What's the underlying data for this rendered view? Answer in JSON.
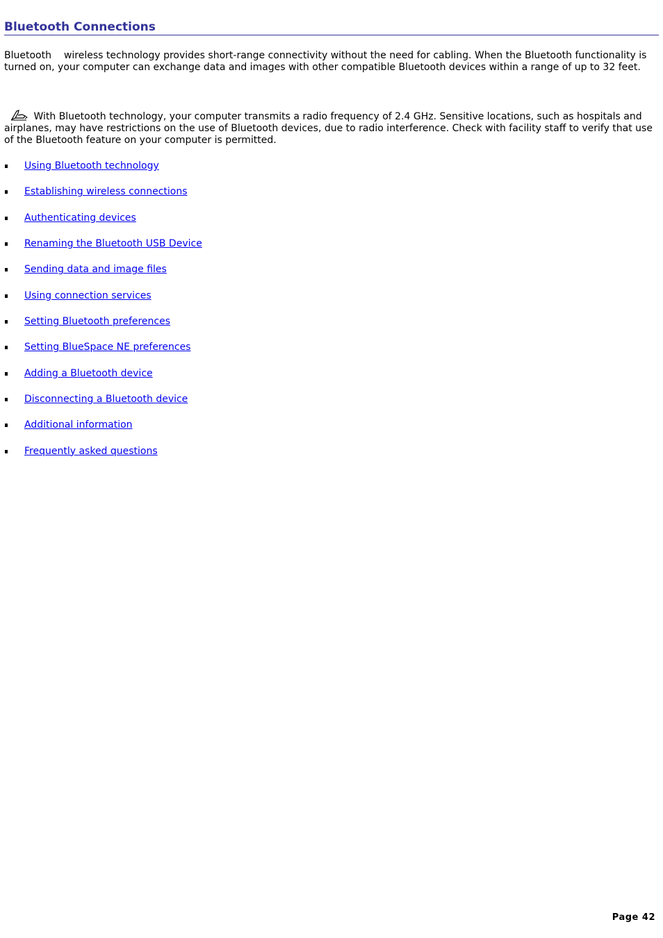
{
  "page": {
    "title": "Bluetooth Connections",
    "intro_prefix": "Bluetooth",
    "intro_rest": "wireless technology provides short-range connectivity without the need for cabling. When the Bluetooth functionality is turned on, your computer can exchange data and images with other compatible Bluetooth devices within a range of up to 32 feet.",
    "note_icon": "note-pen-icon",
    "note": "With Bluetooth technology, your computer transmits a radio frequency of 2.4 GHz. Sensitive locations, such as hospitals and airplanes, may have restrictions on the use of Bluetooth devices, due to radio interference. Check with facility staff to verify that use of the Bluetooth feature on your computer is permitted.",
    "links": [
      "Using Bluetooth technology",
      "Establishing wireless connections",
      "Authenticating devices",
      "Renaming the Bluetooth USB Device",
      "Sending data and image files",
      "Using connection services",
      "Setting Bluetooth preferences",
      "Setting BlueSpace NE preferences",
      "Adding a Bluetooth device",
      "Disconnecting a Bluetooth device",
      "Additional information",
      "Frequently asked questions"
    ],
    "page_number": "Page 42",
    "colors": {
      "heading": "#333399",
      "link": "#0000ee",
      "text": "#000000"
    }
  }
}
